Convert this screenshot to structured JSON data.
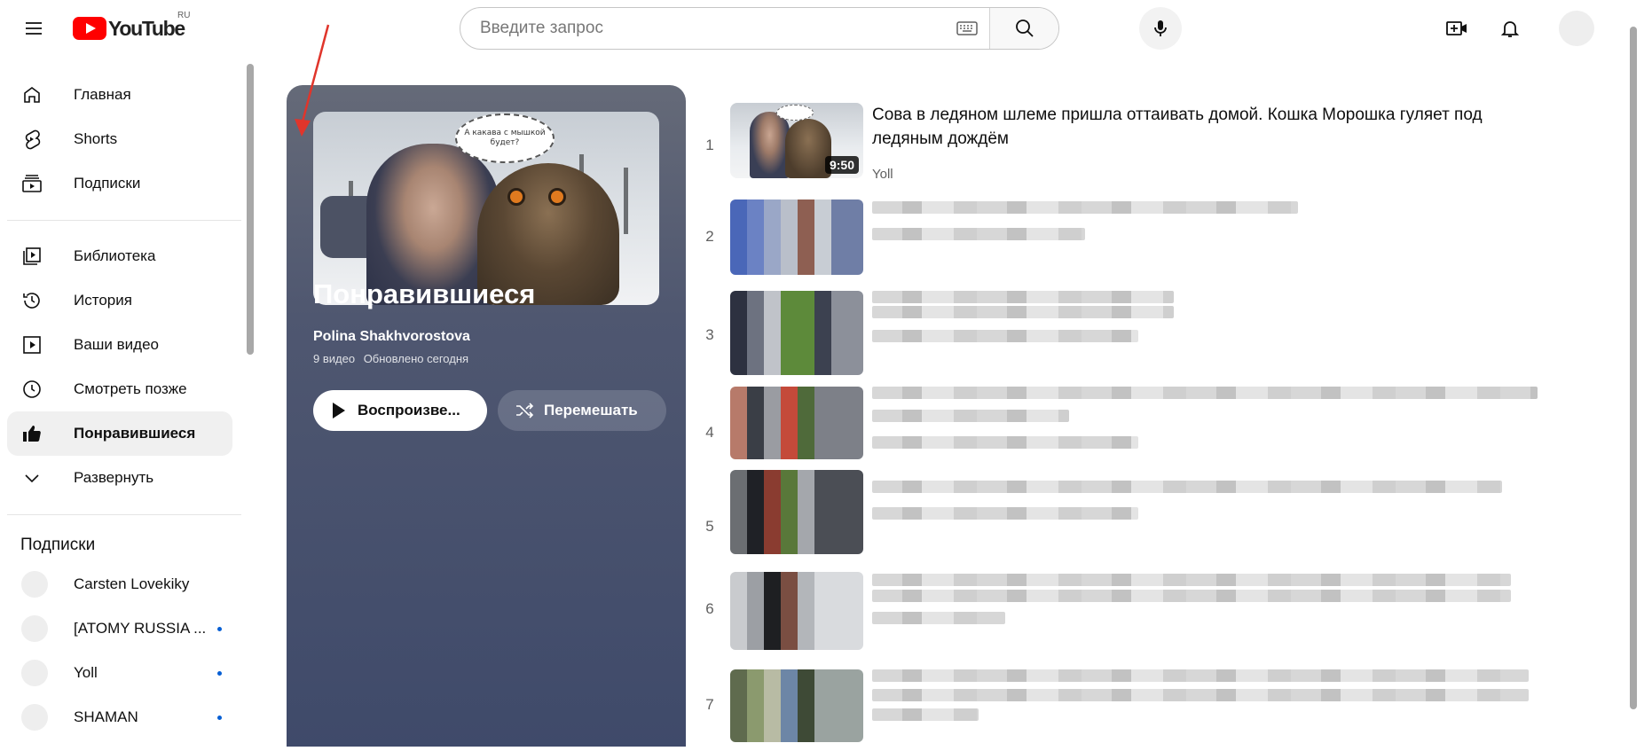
{
  "header": {
    "logo_text": "YouTube",
    "country_code": "RU",
    "search_placeholder": "Введите запрос"
  },
  "sidebar": {
    "items": [
      {
        "label": "Главная",
        "icon": "home-icon"
      },
      {
        "label": "Shorts",
        "icon": "shorts-icon"
      },
      {
        "label": "Подписки",
        "icon": "subscriptions-icon"
      },
      {
        "label": "Библиотека",
        "icon": "library-icon"
      },
      {
        "label": "История",
        "icon": "history-icon"
      },
      {
        "label": "Ваши видео",
        "icon": "your-videos-icon"
      },
      {
        "label": "Смотреть позже",
        "icon": "watch-later-icon"
      },
      {
        "label": "Понравившиеся",
        "icon": "liked-icon",
        "active": true
      },
      {
        "label": "Развернуть",
        "icon": "chevron-down-icon"
      }
    ],
    "subscriptions_heading": "Подписки",
    "subscriptions": [
      {
        "name": "Carsten Lovekiky",
        "new": false
      },
      {
        "name": "[ATOMY RUSSIA ...",
        "new": true
      },
      {
        "name": "Yoll",
        "new": true
      },
      {
        "name": "SHAMAN",
        "new": true
      }
    ]
  },
  "playlist": {
    "title": "Понравившиеся",
    "owner": "Polina Shakhvorostova",
    "video_count": "9 видео",
    "updated": "Обновлено сегодня",
    "play_label": "Воспроизве...",
    "shuffle_label": "Перемешать",
    "cover_bubble_text": "А какава с мышкой будет?"
  },
  "videos": [
    {
      "index": "1",
      "title": "Сова в ледяном шлеме пришла оттаивать домой. Кошка Морошка гуляет под ледяным дождём",
      "channel": "Yoll",
      "duration": "9:50"
    },
    {
      "index": "2"
    },
    {
      "index": "3"
    },
    {
      "index": "4"
    },
    {
      "index": "5"
    },
    {
      "index": "6"
    },
    {
      "index": "7"
    }
  ],
  "colors": {
    "brand_red": "#ff0000",
    "panel_top": "#656a78",
    "panel_bottom": "#3f4a6a",
    "accent_blue": "#065fd4"
  }
}
